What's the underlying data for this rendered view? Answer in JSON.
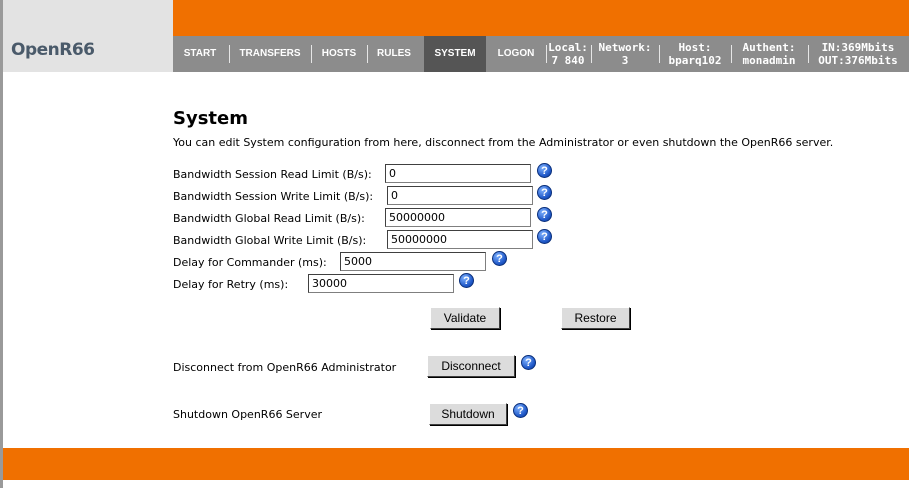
{
  "app": {
    "logo": "OpenR66"
  },
  "nav": {
    "items": [
      {
        "label": "START",
        "active": false
      },
      {
        "label": "TRANSFERS",
        "active": false
      },
      {
        "label": "HOSTS",
        "active": false
      },
      {
        "label": "RULES",
        "active": false
      },
      {
        "label": "SYSTEM",
        "active": true
      },
      {
        "label": "LOGON",
        "active": false
      }
    ],
    "stats": [
      {
        "line1": "Local:",
        "line2": "7 840"
      },
      {
        "line1": "Network:",
        "line2": "3"
      },
      {
        "line1": "Host:",
        "line2": "bparq102"
      },
      {
        "line1": "Authent:",
        "line2": "monadmin"
      },
      {
        "line1": "IN:369Mbits",
        "line2": "OUT:376Mbits"
      }
    ]
  },
  "page": {
    "title": "System",
    "intro": "You can edit System configuration from here, disconnect from the Administrator or even shutdown the OpenR66 server."
  },
  "form": {
    "fields": [
      {
        "label": "Bandwidth Session Read Limit (B/s):",
        "value": "0"
      },
      {
        "label": "Bandwidth Session Write Limit (B/s):",
        "value": "0"
      },
      {
        "label": "Bandwidth Global Read Limit (B/s):",
        "value": "50000000"
      },
      {
        "label": "Bandwidth Global Write Limit (B/s):",
        "value": "50000000"
      },
      {
        "label": "Delay for Commander (ms):",
        "value": "5000"
      },
      {
        "label": "Delay for Retry (ms):",
        "value": "30000"
      }
    ],
    "help_glyph": "?",
    "validate_label": "Validate",
    "restore_label": "Restore"
  },
  "disconnect": {
    "label": "Disconnect from OpenR66 Administrator",
    "button": "Disconnect"
  },
  "shutdown": {
    "label": "Shutdown OpenR66 Server",
    "button": "Shutdown"
  },
  "colors": {
    "accent_orange": "#f07000",
    "nav_gray": "#8c8c8c",
    "nav_active": "#555555",
    "help_blue": "#1f58c8"
  }
}
